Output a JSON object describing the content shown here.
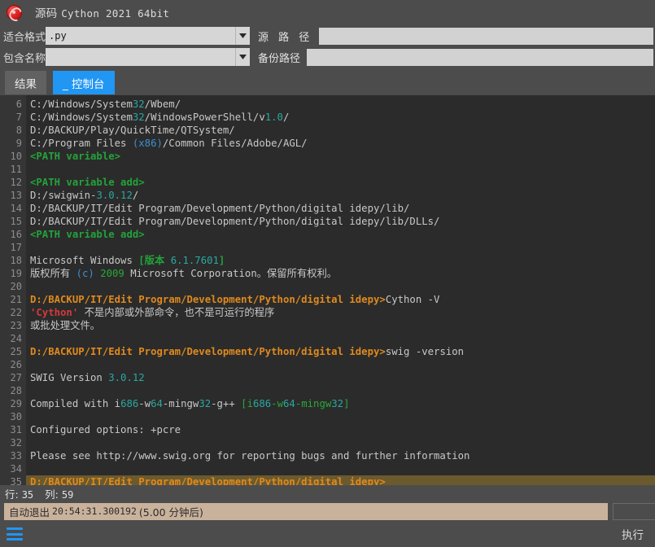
{
  "window": {
    "title_cn": "源码",
    "title_en": "Cython 2021 64bit",
    "logo_icon": "app-logo-icon"
  },
  "form": {
    "format_label": "适合格式",
    "format_value": ".py",
    "format_placeholder": "",
    "package_label": "包含名称",
    "package_value": "",
    "package_placeholder": "",
    "source_path_label": "源 路 径",
    "source_path_value": "",
    "backup_path_label": "备份路径",
    "backup_path_value": "",
    "dropdown_icon": "chevron-down-icon"
  },
  "tabs": [
    {
      "label": "结果",
      "active": false
    },
    {
      "label": "_ 控制台",
      "active": true
    }
  ],
  "console": {
    "first_line_number": 6,
    "lines": [
      {
        "n": 6,
        "hl": false,
        "spans": [
          {
            "t": "C:/Windows/System",
            "c": "plain"
          },
          {
            "t": "32",
            "c": "teal"
          },
          {
            "t": "/Wbem/",
            "c": "plain"
          }
        ]
      },
      {
        "n": 7,
        "hl": false,
        "spans": [
          {
            "t": "C:/Windows/System",
            "c": "plain"
          },
          {
            "t": "32",
            "c": "teal"
          },
          {
            "t": "/WindowsPowerShell/v",
            "c": "plain"
          },
          {
            "t": "1.0",
            "c": "teal"
          },
          {
            "t": "/",
            "c": "plain"
          }
        ]
      },
      {
        "n": 8,
        "hl": false,
        "spans": [
          {
            "t": "D:/BACKUP/Play/QuickTime/QTSystem/",
            "c": "plain"
          }
        ]
      },
      {
        "n": 9,
        "hl": false,
        "spans": [
          {
            "t": "C:/Program Files ",
            "c": "plain"
          },
          {
            "t": "(x86)",
            "c": "blue"
          },
          {
            "t": "/Common Files/Adobe/AGL/",
            "c": "plain"
          }
        ]
      },
      {
        "n": 10,
        "hl": false,
        "spans": [
          {
            "t": "<PATH variable>",
            "c": "green"
          }
        ]
      },
      {
        "n": 11,
        "hl": false,
        "spans": [
          {
            "t": "",
            "c": "plain"
          }
        ]
      },
      {
        "n": 12,
        "hl": false,
        "spans": [
          {
            "t": "<PATH variable add>",
            "c": "green"
          }
        ]
      },
      {
        "n": 13,
        "hl": false,
        "spans": [
          {
            "t": "D:/swigwin-",
            "c": "plain"
          },
          {
            "t": "3.0.12",
            "c": "teal"
          },
          {
            "t": "/",
            "c": "plain"
          }
        ]
      },
      {
        "n": 14,
        "hl": false,
        "spans": [
          {
            "t": "D:/BACKUP/IT/Edit Program/Development/Python/digital idepy/lib/",
            "c": "plain"
          }
        ]
      },
      {
        "n": 15,
        "hl": false,
        "spans": [
          {
            "t": "D:/BACKUP/IT/Edit Program/Development/Python/digital idepy/lib/DLLs/",
            "c": "plain"
          }
        ]
      },
      {
        "n": 16,
        "hl": false,
        "spans": [
          {
            "t": "<PATH variable add>",
            "c": "green"
          }
        ]
      },
      {
        "n": 17,
        "hl": false,
        "spans": [
          {
            "t": "",
            "c": "plain"
          }
        ]
      },
      {
        "n": 18,
        "hl": false,
        "spans": [
          {
            "t": "Microsoft Windows ",
            "c": "plain"
          },
          {
            "t": "[",
            "c": "green"
          },
          {
            "t": "版本",
            "c": "green"
          },
          {
            "t": " ",
            "c": "plain"
          },
          {
            "t": "6.1.7601",
            "c": "teal"
          },
          {
            "t": "]",
            "c": "green"
          }
        ]
      },
      {
        "n": 19,
        "hl": false,
        "spans": [
          {
            "t": "版权所有 ",
            "c": "plain"
          },
          {
            "t": "(c)",
            "c": "blue"
          },
          {
            "t": " ",
            "c": "plain"
          },
          {
            "t": "2009",
            "c": "green2"
          },
          {
            "t": " Microsoft Corporation。保留所有权利。",
            "c": "plain"
          }
        ]
      },
      {
        "n": 20,
        "hl": false,
        "spans": [
          {
            "t": "",
            "c": "plain"
          }
        ]
      },
      {
        "n": 21,
        "hl": false,
        "spans": [
          {
            "t": "D:/BACKUP/IT/Edit Program/Development/Python/digital idepy>",
            "c": "orange"
          },
          {
            "t": "Cython -V",
            "c": "plain"
          }
        ]
      },
      {
        "n": 22,
        "hl": false,
        "spans": [
          {
            "t": "'Cython'",
            "c": "red"
          },
          {
            "t": " 不是内部或外部命令，也不是可运行的程序",
            "c": "plain"
          }
        ]
      },
      {
        "n": 23,
        "hl": false,
        "spans": [
          {
            "t": "或批处理文件。",
            "c": "plain"
          }
        ]
      },
      {
        "n": 24,
        "hl": false,
        "spans": [
          {
            "t": "",
            "c": "plain"
          }
        ]
      },
      {
        "n": 25,
        "hl": false,
        "spans": [
          {
            "t": "D:/BACKUP/IT/Edit Program/Development/Python/digital idepy>",
            "c": "orange"
          },
          {
            "t": "swig -version",
            "c": "plain"
          }
        ]
      },
      {
        "n": 26,
        "hl": false,
        "spans": [
          {
            "t": "",
            "c": "plain"
          }
        ]
      },
      {
        "n": 27,
        "hl": false,
        "spans": [
          {
            "t": "SWIG Version ",
            "c": "plain"
          },
          {
            "t": "3.0.12",
            "c": "teal"
          }
        ]
      },
      {
        "n": 28,
        "hl": false,
        "spans": [
          {
            "t": "",
            "c": "plain"
          }
        ]
      },
      {
        "n": 29,
        "hl": false,
        "spans": [
          {
            "t": "Compiled with i",
            "c": "plain"
          },
          {
            "t": "686",
            "c": "teal"
          },
          {
            "t": "-w",
            "c": "plain"
          },
          {
            "t": "64",
            "c": "teal"
          },
          {
            "t": "-mingw",
            "c": "plain"
          },
          {
            "t": "32",
            "c": "teal"
          },
          {
            "t": "-g++ ",
            "c": "plain"
          },
          {
            "t": "[i",
            "c": "green2"
          },
          {
            "t": "686",
            "c": "teal"
          },
          {
            "t": "-w",
            "c": "green2"
          },
          {
            "t": "64",
            "c": "teal"
          },
          {
            "t": "-mingw",
            "c": "green2"
          },
          {
            "t": "32",
            "c": "teal"
          },
          {
            "t": "]",
            "c": "green2"
          }
        ]
      },
      {
        "n": 30,
        "hl": false,
        "spans": [
          {
            "t": "",
            "c": "plain"
          }
        ]
      },
      {
        "n": 31,
        "hl": false,
        "spans": [
          {
            "t": "Configured options: +pcre",
            "c": "plain"
          }
        ]
      },
      {
        "n": 32,
        "hl": false,
        "spans": [
          {
            "t": "",
            "c": "plain"
          }
        ]
      },
      {
        "n": 33,
        "hl": false,
        "spans": [
          {
            "t": "Please see http://www.swig.org for reporting bugs and further information",
            "c": "plain"
          }
        ]
      },
      {
        "n": 34,
        "hl": false,
        "spans": [
          {
            "t": "",
            "c": "plain"
          }
        ]
      },
      {
        "n": 35,
        "hl": true,
        "spans": [
          {
            "t": "D:/BACKUP/IT/Edit Program/Development/Python/digital idepy>",
            "c": "orange"
          }
        ]
      }
    ]
  },
  "status": {
    "row_label": "行:",
    "row_value": "35",
    "col_label": "列:",
    "col_value": "59"
  },
  "banner": {
    "prefix": "自动退出",
    "timestamp": "20:54:31.300192",
    "suffix": "(5.00 分钟后)",
    "side_input_value": "",
    "bg_color": "#c9b29c"
  },
  "footer": {
    "menu_icon": "hamburger-menu-icon",
    "execute_label": "执行"
  },
  "colors": {
    "window_bg": "#4c4c4c",
    "console_bg": "#2b2b2b",
    "gutter_bg": "#353535",
    "accent_blue": "#2196f3",
    "highlight_line": "#6b5a2e",
    "prompt_orange": "#e08a1e"
  }
}
